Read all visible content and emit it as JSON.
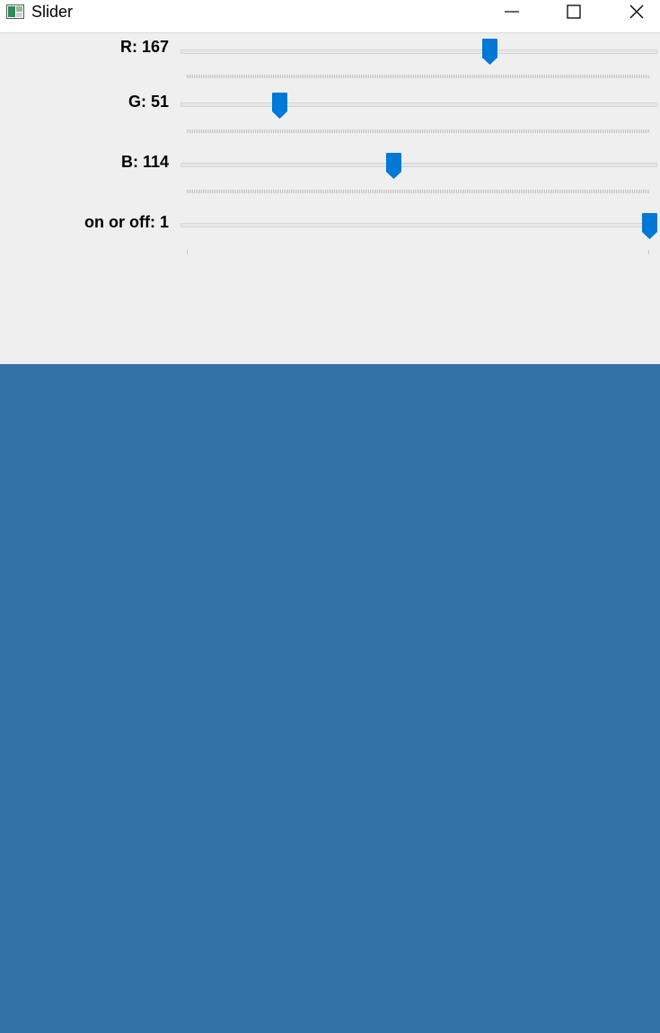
{
  "window": {
    "title": "Slider"
  },
  "trackbars": [
    {
      "label": "R: 167",
      "name": "R",
      "value": 167,
      "max": 255,
      "fraction": 0.6549
    },
    {
      "label": "G: 51",
      "name": "G",
      "value": 51,
      "max": 255,
      "fraction": 0.2
    },
    {
      "label": "B: 114",
      "name": "B",
      "value": 114,
      "max": 255,
      "fraction": 0.4471
    },
    {
      "label": "on or off: 1",
      "name": "on or off",
      "value": 1,
      "max": 1,
      "fraction": 1.0
    }
  ],
  "colors": {
    "thumb": "#0078d7",
    "panel_bg": "#efefef",
    "image_fill": "#3371a7"
  }
}
